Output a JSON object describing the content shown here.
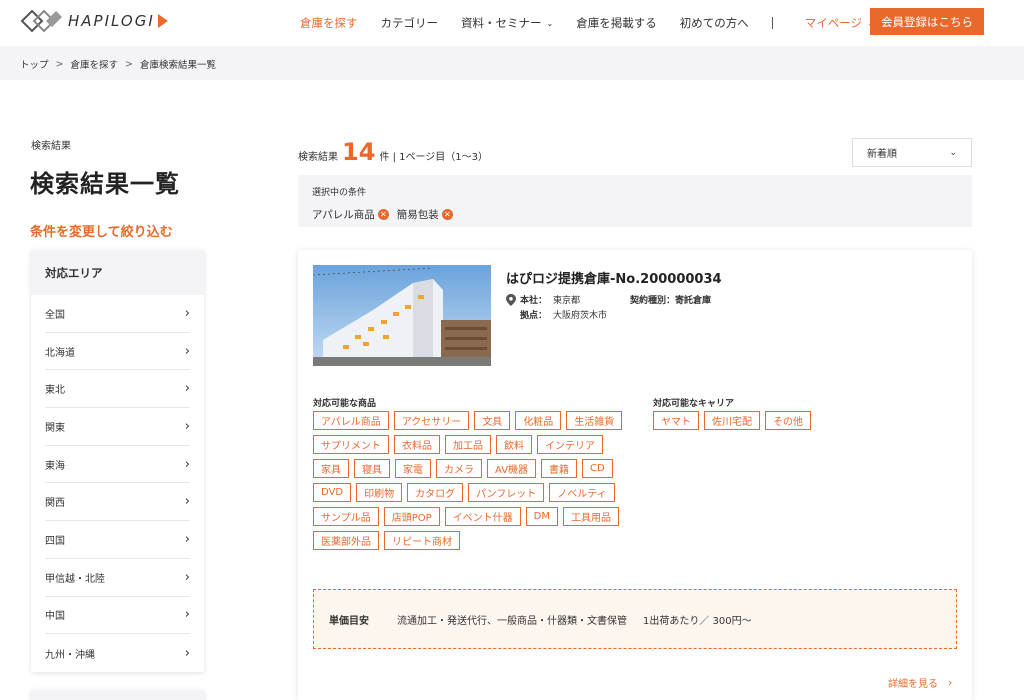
{
  "header": {
    "logo_text": "HAPILOGI",
    "nav": [
      {
        "label": "倉庫を探す",
        "active": true,
        "dropdown": false
      },
      {
        "label": "カテゴリー",
        "active": false,
        "dropdown": false
      },
      {
        "label": "資料・セミナー",
        "active": false,
        "dropdown": true
      },
      {
        "label": "倉庫を掲載する",
        "active": false,
        "dropdown": false
      },
      {
        "label": "初めての方へ",
        "active": false,
        "dropdown": false
      }
    ],
    "mypage": "マイページ",
    "register": "会員登録はこちら"
  },
  "breadcrumb": [
    "トップ",
    "倉庫を探す",
    "倉庫検索結果一覧"
  ],
  "sidebar": {
    "small_label": "検索結果",
    "title": "検索結果一覧",
    "filter_heading": "条件を変更して絞り込む",
    "area_heading": "対応エリア",
    "areas": [
      "全国",
      "北海道",
      "東北",
      "関東",
      "東海",
      "関西",
      "四国",
      "甲信越・北陸",
      "中国",
      "九州・沖縄"
    ]
  },
  "results": {
    "prefix": "検索結果",
    "count": "14",
    "suffix": "件 | 1ページ目（1〜3）",
    "sort": "新着順",
    "conditions_label": "選択中の条件",
    "conditions": [
      "アパレル商品",
      "簡易包装"
    ]
  },
  "card": {
    "title": "はぴロジ提携倉庫-No.200000034",
    "hq_label": "本社：",
    "hq_value": "東京都",
    "base_label": "拠点：",
    "base_value": "大阪府茨木市",
    "contract_label": "契約種別：",
    "contract_value": "寄託倉庫",
    "products_label": "対応可能な商品",
    "products": [
      "アパレル商品",
      "アクセサリー",
      "文具",
      "化粧品",
      "生活雑貨",
      "サプリメント",
      "衣料品",
      "加工品",
      "飲料",
      "インテリア",
      "家具",
      "寝具",
      "家電",
      "カメラ",
      "AV機器",
      "書籍",
      "CD",
      "DVD",
      "印刷物",
      "カタログ",
      "パンフレット",
      "ノベルティ",
      "サンプル品",
      "店頭POP",
      "イベント什器",
      "DM",
      "工具用品",
      "医薬部外品",
      "リピート商材"
    ],
    "carriers_label": "対応可能なキャリア",
    "carriers": [
      "ヤマト",
      "佐川宅配",
      "その他"
    ],
    "price_label": "単価目安",
    "price_desc": "流通加工・発送代行、一般商品・什器類・文書保管",
    "price_value": "1出荷あたり／ 300円〜",
    "detail_link": "詳細を見る"
  },
  "colors": {
    "accent": "#e9692c"
  }
}
